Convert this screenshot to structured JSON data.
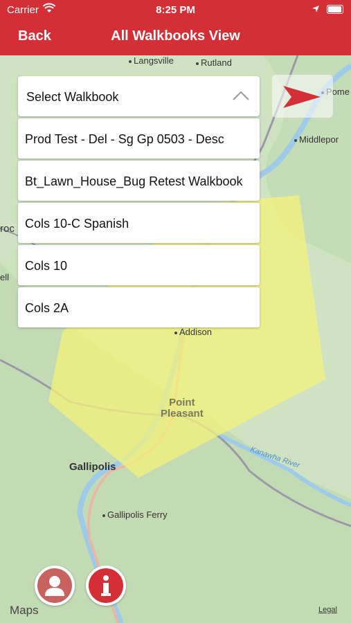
{
  "status_bar": {
    "carrier": "Carrier",
    "time": "8:25 PM"
  },
  "nav": {
    "back_label": "Back",
    "title": "All Walkbooks View"
  },
  "dropdown": {
    "placeholder": "Select Walkbook",
    "items": [
      "Prod Test - Del - Sg Gp 0503 - Desc",
      "Bt_Lawn_House_Bug Retest Walkbook",
      "Cols 10-C Spanish",
      "Cols 10",
      "Cols 2A"
    ]
  },
  "map_labels": {
    "langsville": "Langsville",
    "rutland": "Rutland",
    "pome": "Pome",
    "middleport": "Middlepor",
    "roc": "roc",
    "ell": "ell",
    "addison": "Addison",
    "point_pleasant_1": "Point",
    "point_pleasant_2": "Pleasant",
    "kanawha_river": "Kanawha River",
    "gallipolis": "Gallipolis",
    "gallipolis_ferry": "Gallipolis Ferry"
  },
  "footer": {
    "maps": "Maps",
    "legal": "Legal"
  },
  "colors": {
    "accent": "#d42f37",
    "overlay": "#f4f27a"
  }
}
